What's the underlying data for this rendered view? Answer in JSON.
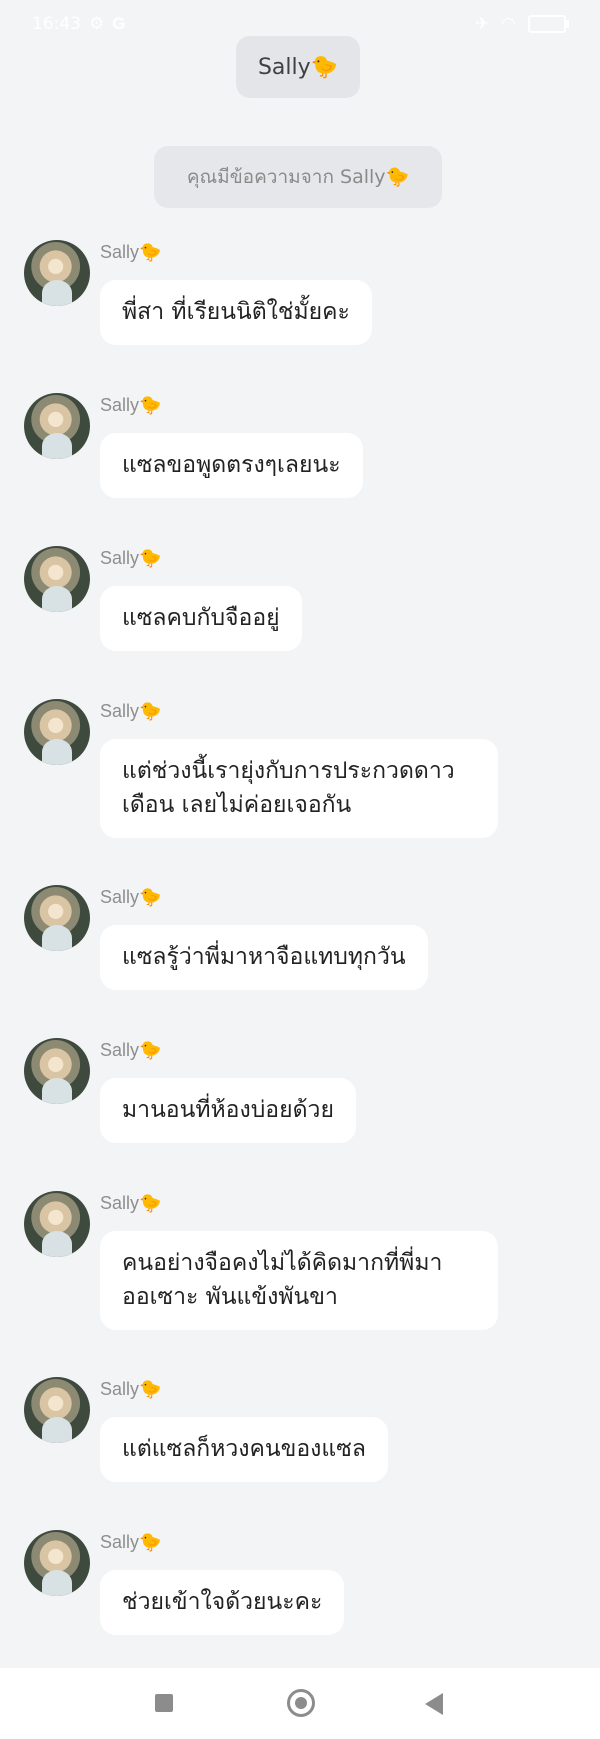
{
  "status_bar": {
    "time": "16:43",
    "left_icons": [
      "notification-icon",
      "google-icon"
    ],
    "right_icons": [
      "airplane-icon",
      "wifi-icon",
      "battery-icon"
    ]
  },
  "header": {
    "title": "Sally🐤"
  },
  "notice": {
    "text": "คุณมีข้อความจาก Sally🐤"
  },
  "messages": [
    {
      "sender": "Sally🐤",
      "text": "พี่สา ที่เรียนนิติใช่มั้ยคะ"
    },
    {
      "sender": "Sally🐤",
      "text": "แซลขอพูดตรงๆเลยนะ"
    },
    {
      "sender": "Sally🐤",
      "text": "แซลคบกับจืออยู่"
    },
    {
      "sender": "Sally🐤",
      "text": "แต่ช่วงนี้เรายุ่งกับการประกวดดาวเดือน เลยไม่ค่อยเจอกัน"
    },
    {
      "sender": "Sally🐤",
      "text": "แซลรู้ว่าพี่มาหาจือแทบทุกวัน"
    },
    {
      "sender": "Sally🐤",
      "text": "มานอนที่ห้องบ่อยด้วย"
    },
    {
      "sender": "Sally🐤",
      "text": "คนอย่างจือคงไม่ได้คิดมากที่พี่มาออเซาะ พันแข้งพันขา"
    },
    {
      "sender": "Sally🐤",
      "text": "แต่แซลก็หวงคนของแซล"
    },
    {
      "sender": "Sally🐤",
      "text": "ช่วยเข้าใจด้วยนะคะ"
    }
  ],
  "nav": {
    "icons": [
      "recent-apps-icon",
      "home-icon",
      "back-icon"
    ]
  }
}
